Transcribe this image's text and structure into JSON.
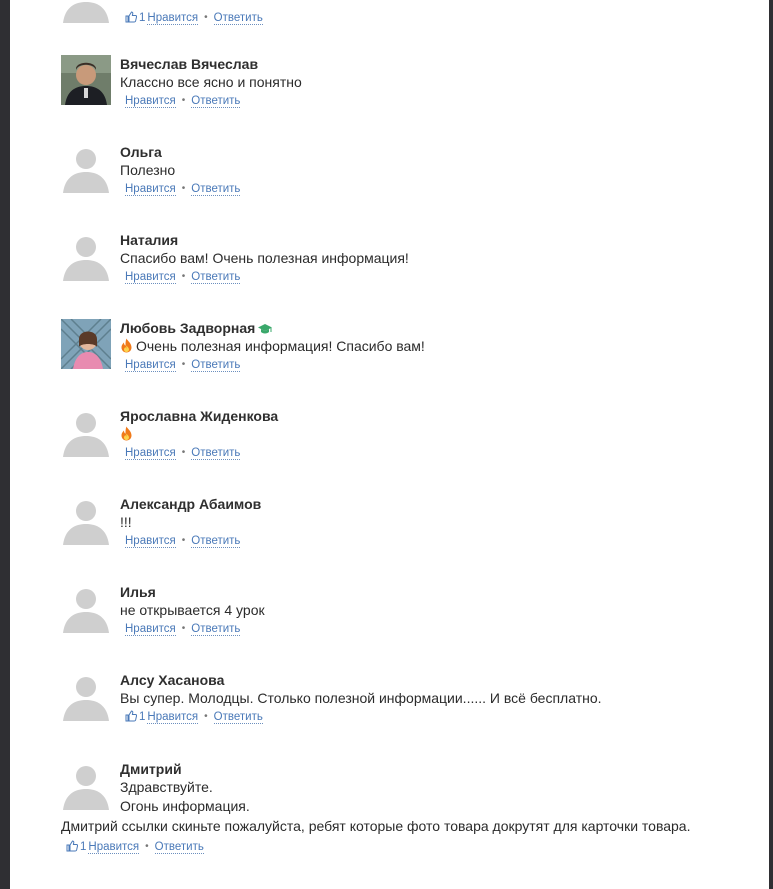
{
  "colors": {
    "link": "#4a79b8",
    "avatar_placeholder": "#cfcfcf",
    "frame": "#2f2f33"
  },
  "common": {
    "like_label": "Нравится",
    "reply_label": "Ответить",
    "separator": "•"
  },
  "top_partial": {
    "like_count": "1"
  },
  "comments": [
    {
      "author": "Вячеслав Вячеслав",
      "text": "Классно все ясно и понятно",
      "avatar": "photo-man"
    },
    {
      "author": "Ольга",
      "text": "Полезно",
      "avatar": "placeholder"
    },
    {
      "author": "Наталия",
      "text": "Спасибо вам! Очень полезная информация!",
      "avatar": "placeholder"
    },
    {
      "author": "Любовь Задворная",
      "text": "Очень полезная информация! Спасибо вам!",
      "avatar": "photo-girl",
      "badge": "graduation-cap-icon",
      "emoji": "fire-icon"
    },
    {
      "author": "Ярославна Жиденкова",
      "text": "",
      "avatar": "placeholder",
      "emoji": "fire-icon"
    },
    {
      "author": "Александр Абаимов",
      "text": "!!!",
      "avatar": "placeholder"
    },
    {
      "author": "Илья",
      "text": "не открывается 4 урок",
      "avatar": "placeholder"
    },
    {
      "author": "Алсу Хасанова",
      "text": "Вы супер. Молодцы. Столько полезной информации...... И всё бесплатно.",
      "avatar": "placeholder",
      "like_count": "1"
    },
    {
      "author": "Дмитрий",
      "text_lines": [
        "Здравствуйте.",
        "Огонь информация."
      ],
      "full_line": "Дмитрий ссылки скиньте пожалуйста, ребят которые фото товара докрутят для карточки товара.",
      "avatar": "placeholder",
      "like_count": "1"
    }
  ]
}
